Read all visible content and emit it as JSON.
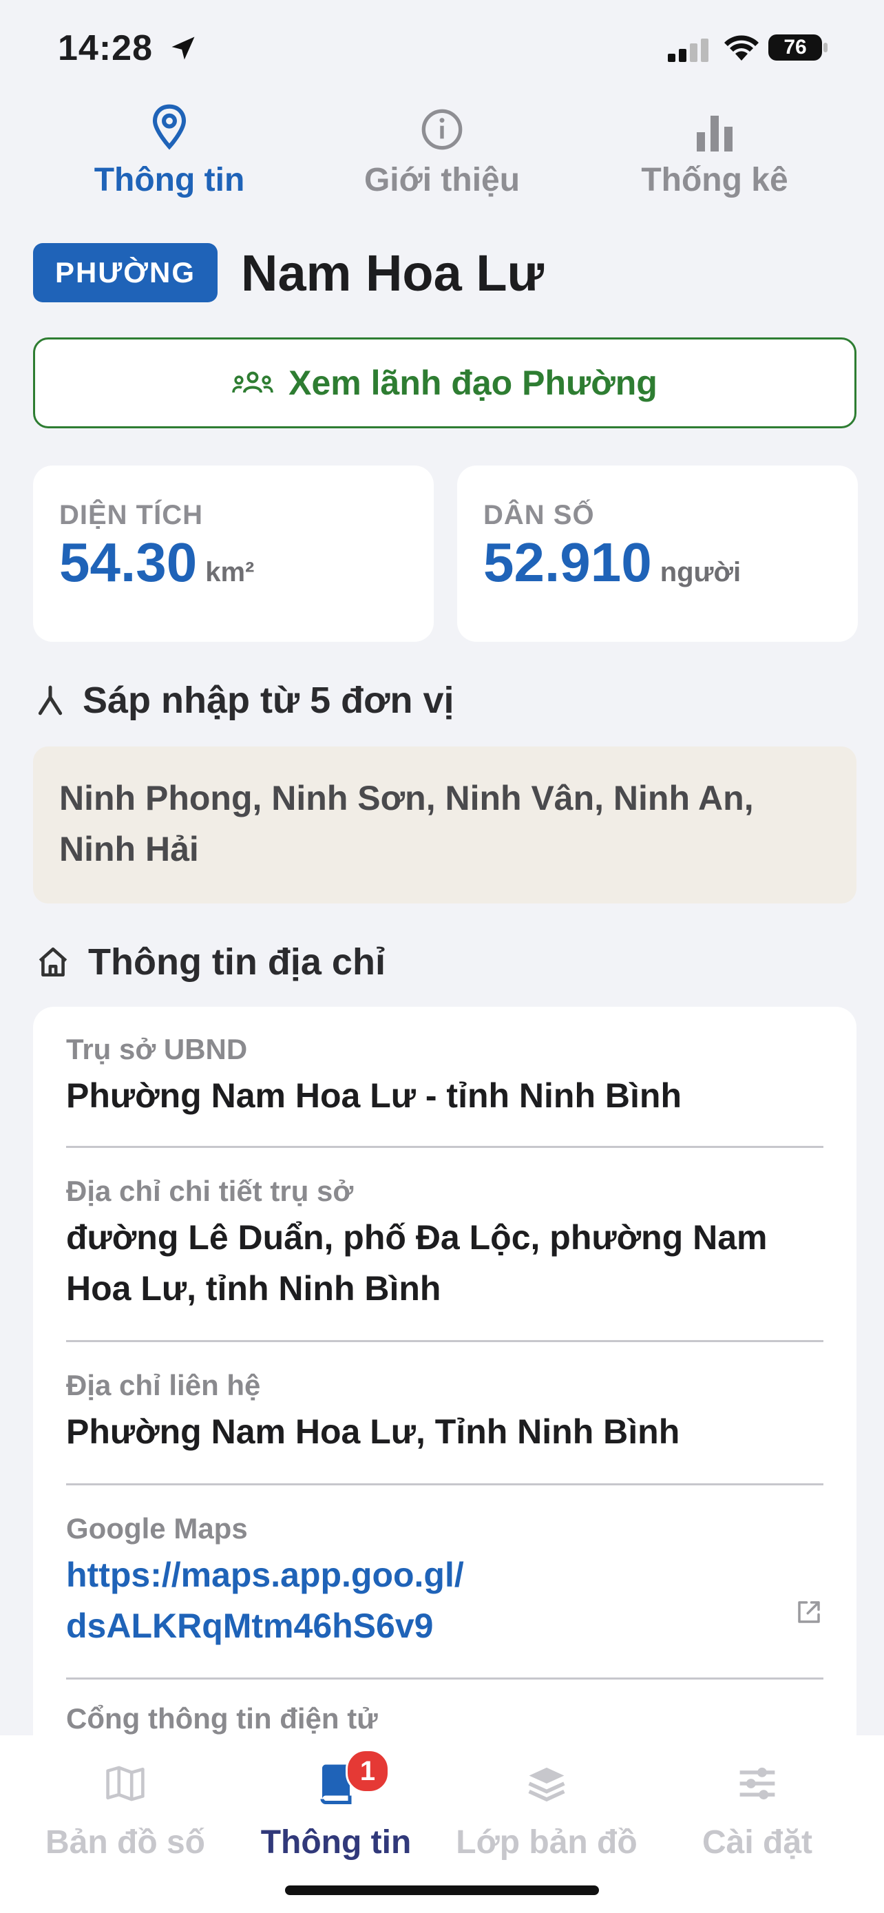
{
  "status_bar": {
    "time": "14:28",
    "battery": "76"
  },
  "top_tabs": [
    {
      "label": "Thông tin",
      "icon": "location-pin-icon",
      "active": true
    },
    {
      "label": "Giới thiệu",
      "icon": "info-icon",
      "active": false
    },
    {
      "label": "Thống kê",
      "icon": "bar-chart-icon",
      "active": false
    }
  ],
  "unit": {
    "level": "PHƯỜNG",
    "name": "Nam Hoa Lư"
  },
  "leaders_button": {
    "label": "Xem lãnh đạo Phường"
  },
  "stats": {
    "area": {
      "caption": "DIỆN TÍCH",
      "value": "54.30",
      "unit": "km²"
    },
    "population": {
      "caption": "DÂN SỐ",
      "value": "52.910",
      "unit": "người"
    }
  },
  "merged": {
    "title": "Sáp nhập từ 5 đơn vị",
    "line1": "Ninh Phong, Ninh Sơn, Ninh Vân, Ninh An,",
    "line2": "Ninh Hải"
  },
  "address": {
    "title": "Thông tin địa chỉ",
    "items": [
      {
        "label": "Trụ sở UBND",
        "value": "Phường Nam Hoa Lư - tỉnh Ninh Bình"
      },
      {
        "label": "Địa chỉ chi tiết trụ sở",
        "line1": "đường Lê Duẩn, phố Đa Lộc, phường Nam",
        "line2": "Hoa Lư, tỉnh Ninh Bình"
      },
      {
        "label": "Địa chỉ liên hệ",
        "value": "Phường Nam Hoa Lư, Tỉnh Ninh Bình"
      },
      {
        "label": "Google Maps",
        "line1": "https://maps.app.goo.gl/",
        "line2": "dsALKRqMtm46hS6v9"
      },
      {
        "label": "Cổng thông tin điện tử"
      }
    ]
  },
  "bottom_nav": [
    {
      "label": "Bản đồ số",
      "icon": "map-icon",
      "active": false
    },
    {
      "label": "Thông tin",
      "icon": "book-icon",
      "active": true,
      "badge": "1"
    },
    {
      "label": "Lớp bản đồ",
      "icon": "layers-icon",
      "active": false
    },
    {
      "label": "Cài đặt",
      "icon": "sliders-icon",
      "active": false
    }
  ],
  "colors": {
    "primary": "#1f63b8",
    "green": "#2e7d32",
    "badge": "#e53935",
    "nav_active": "#31397a"
  }
}
